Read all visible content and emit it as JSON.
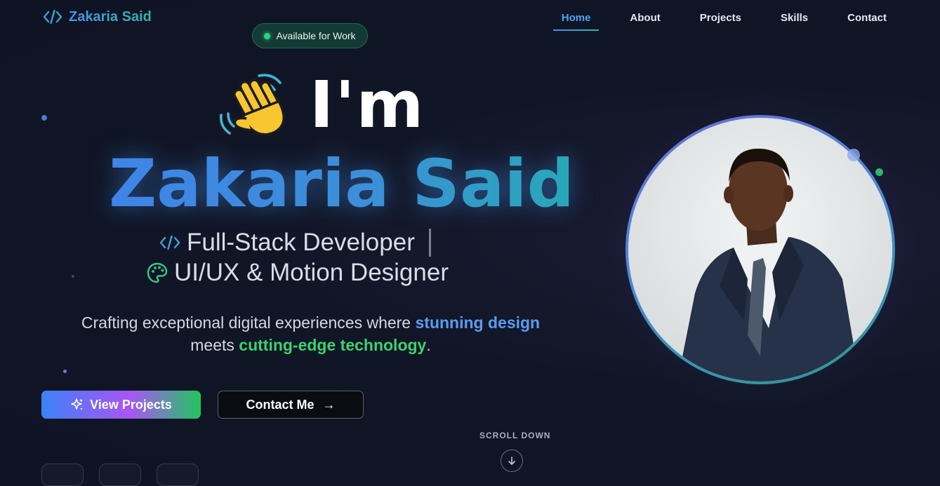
{
  "brand": {
    "name": "Zakaria Said",
    "icon": "code-brackets-icon"
  },
  "nav": {
    "links": [
      {
        "label": "Home",
        "active": true
      },
      {
        "label": "About",
        "active": false
      },
      {
        "label": "Projects",
        "active": false
      },
      {
        "label": "Skills",
        "active": false
      },
      {
        "label": "Contact",
        "active": false
      }
    ]
  },
  "status_badge": {
    "label": "Available for Work",
    "color": "#2fd07a"
  },
  "hero": {
    "greeting": "I'm",
    "greeting_icon": "waving-hand-icon",
    "name": "Zakaria Said",
    "roles": [
      {
        "icon": "code-icon",
        "text": "Full-Stack Developer"
      },
      {
        "icon": "palette-icon",
        "text": "UI/UX & Motion Designer"
      }
    ],
    "tagline": {
      "part1": "Crafting exceptional digital experiences where ",
      "highlight1": "stunning design",
      "part2": "meets ",
      "highlight2": "cutting-edge technology",
      "part3": "."
    }
  },
  "buttons": {
    "primary": {
      "label": "View Projects",
      "icon": "sparkle-icon"
    },
    "secondary": {
      "label": "Contact Me",
      "icon": "arrow-right-icon",
      "glyph": "→"
    }
  },
  "scroll": {
    "label": "SCROLL DOWN",
    "icon": "arrow-down-icon"
  },
  "colors": {
    "accent_blue": "#4aa4f0",
    "accent_green": "#3bd36e",
    "background": "#111627"
  }
}
